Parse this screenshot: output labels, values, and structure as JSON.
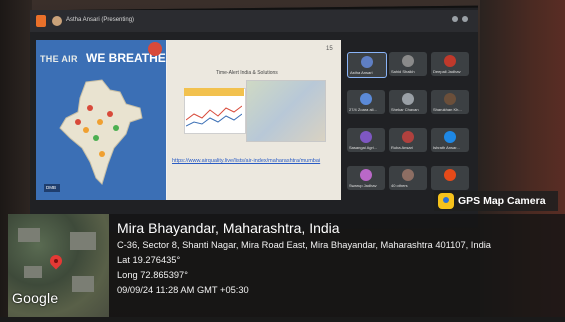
{
  "meeting": {
    "presenter_status": "Astha Ansari (Presenting)",
    "slide": {
      "title_a": "THE AIR",
      "title_b": "WE BREATHE",
      "right_title": "Time-Alert India & Solutions",
      "link_text": "https://www.airquality.live/lists/air-index/maharashtra/mumbai",
      "page_number": "15",
      "button_label": "DMB"
    },
    "participants": [
      {
        "name": "Astha Ansari",
        "color": "#5f7fc4"
      },
      {
        "name": "Sahid Shaikh",
        "color": "#8a8a8a"
      },
      {
        "name": "Deepali Jadhav",
        "color": "#c0392b"
      },
      {
        "name": "27/4 Zoara ali...",
        "color": "#5b8ad8"
      },
      {
        "name": "Shekar Chavan",
        "color": "#9aa0a6"
      },
      {
        "name": "Sharukhan Kh...",
        "color": "#6b4f3a"
      },
      {
        "name": "Sasangai Agri...",
        "color": "#7e57c2"
      },
      {
        "name": "Ruba Ansari",
        "color": "#b0413e"
      },
      {
        "name": "Ishrath Ansar...",
        "color": "#1e88e5"
      },
      {
        "name": "Swarup Jadhav",
        "color": "#ba68c8"
      },
      {
        "name": "40 others",
        "color": "#8d6e63"
      },
      {
        "name": "",
        "color": "#e64a19"
      }
    ]
  },
  "gps": {
    "app_name": "GPS Map Camera",
    "place": "Mira Bhayandar, Maharashtra, India",
    "address": "C-36, Sector 8, Shanti Nagar, Mira Road East, Mira Bhayandar, Maharashtra 401107, India",
    "lat": "Lat 19.276435°",
    "long": "Long 72.865397°",
    "datetime": "09/09/24 11:28 AM GMT +05:30",
    "map_brand": "Google"
  }
}
